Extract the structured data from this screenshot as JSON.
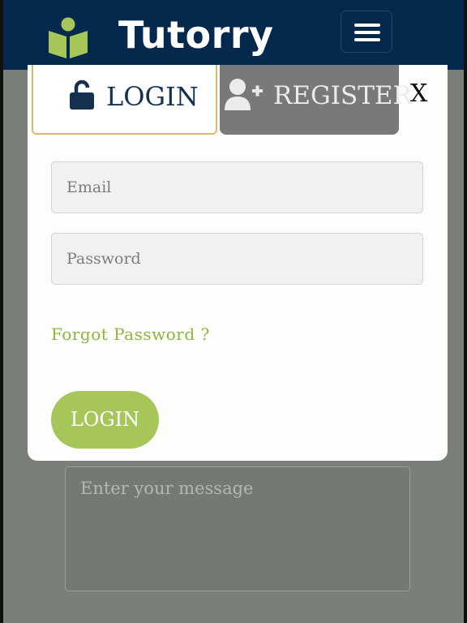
{
  "header": {
    "brand": "Tutorry",
    "logo_icon": "book-reader-icon",
    "menu_icon": "hamburger-menu-icon"
  },
  "background": {
    "message_placeholder": "Enter your message"
  },
  "modal": {
    "tabs": [
      {
        "label": "LOGIN",
        "icon": "unlock-icon",
        "active": true
      },
      {
        "label": "REGISTER",
        "icon": "user-plus-icon",
        "active": false
      }
    ],
    "close_label": "X",
    "email_placeholder": "Email",
    "password_placeholder": "Password",
    "forgot_label": "Forgot Password ?",
    "submit_label": "LOGIN"
  },
  "colors": {
    "header_bg": "#05294d",
    "accent_green": "#a7c65a",
    "link_green": "#8bb83a",
    "tab_border": "#e0b968"
  }
}
